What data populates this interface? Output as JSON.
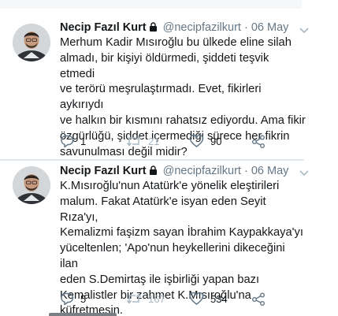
{
  "tweets": [
    {
      "author": {
        "name": "Necip Fazıl Kurt",
        "handle": "@necipfazilkurt",
        "protected": true
      },
      "separator": "·",
      "date": "06 May",
      "text": "Merhum Kadir Mısıroğlu bu ülkede eline silah\nalmadı, bir kişiyi öldürmedi, şiddeti teşvik etmedi\nve terörü meşrulaştırmadı. Evet, fikirleri aykırıydı\nve halkın bir kısmını rahatsız ediyordu. Ama fikir\nözgürlüğü, şiddet içermediği sürece her fikrin\nsavunulması değil midir?",
      "stats": {
        "replies": "1",
        "retweets": "21",
        "likes": "90"
      }
    },
    {
      "author": {
        "name": "Necip Fazıl Kurt",
        "handle": "@necipfazilkurt",
        "protected": true
      },
      "separator": "·",
      "date": "06 May",
      "text": "K.Mısıroğlu'nun Atatürk'e yönelik eleştirileri\nmalum. Fakat Atatürk'e isyan eden Seyit Rıza'yı,\nKemalizmi faşizm sayan İbrahim Kaypakkaya'yı\nyüceltenlen; 'Apo'nun heykellerini dikeceğini ilan\neden S.Demirtaş ile işbirliği yapan bazı\nKemalistler bir zahmet K.Mısıroğlu'na\nküfretmesin.",
      "stats": {
        "replies": "5",
        "retweets": "167",
        "likes": "534"
      }
    }
  ],
  "colors": {
    "text": "#14171a",
    "secondary": "#657786",
    "muted": "#aab8c2",
    "divider": "#e1e8ed"
  },
  "icons": [
    "lock-icon",
    "caret-down-icon",
    "reply-icon",
    "retweet-icon",
    "like-icon",
    "share-icon"
  ]
}
